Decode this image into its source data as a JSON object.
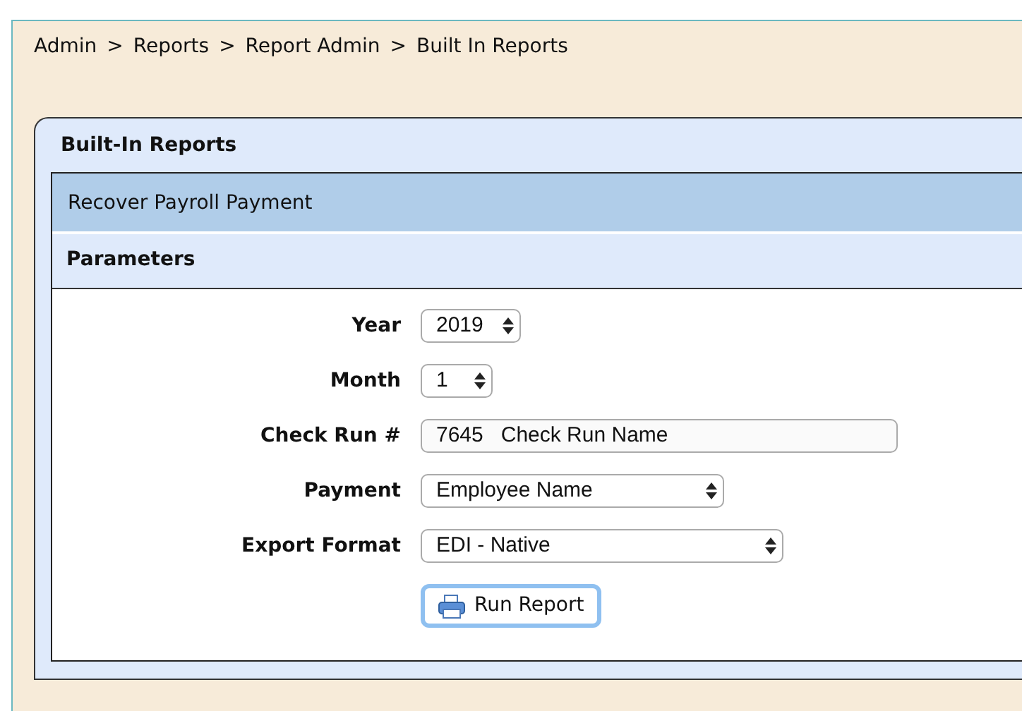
{
  "breadcrumb": [
    "Admin",
    "Reports",
    "Report Admin",
    "Built In Reports"
  ],
  "breadcrumb_separator": ">",
  "panel": {
    "title": "Built-In Reports",
    "report": {
      "title": "Recover Payroll Payment"
    },
    "section": {
      "title": "Parameters"
    },
    "fields": [
      {
        "label": "Year",
        "kind": "select",
        "value": "2019"
      },
      {
        "label": "Month",
        "kind": "select",
        "value": "1"
      },
      {
        "label": "Check Run #",
        "kind": "text",
        "value": "7645   Check Run Name"
      },
      {
        "label": "Payment",
        "kind": "select",
        "value": "Employee Name"
      },
      {
        "label": "Export Format",
        "kind": "select",
        "value": "EDI - Native"
      }
    ],
    "button": {
      "label": "Run Report"
    }
  }
}
